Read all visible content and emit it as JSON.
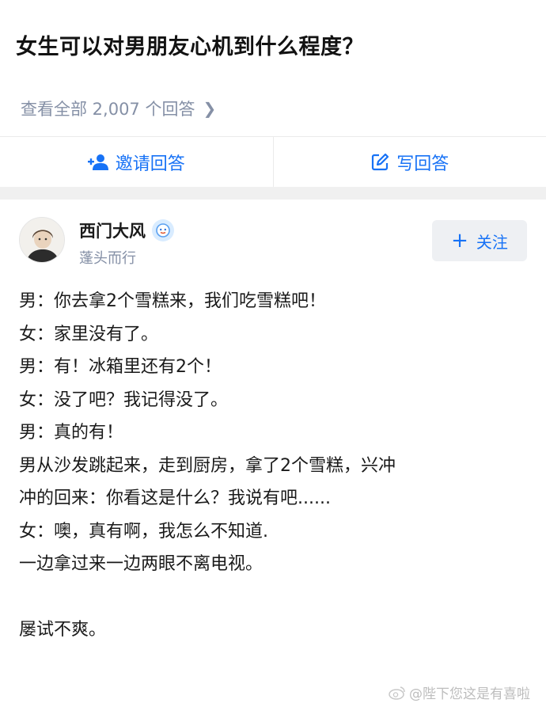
{
  "question": {
    "title": "女生可以对男朋友心机到什么程度？",
    "view_all": "查看全部 2,007 个回答"
  },
  "actions": {
    "invite": "邀请回答",
    "write": "写回答"
  },
  "author": {
    "name": "西门大风",
    "bio": "蓬头而行",
    "follow_label": "关注"
  },
  "answer": {
    "lines": [
      "男：你去拿2个雪糕来，我们吃雪糕吧！",
      "女：家里没有了。",
      "男：有！冰箱里还有2个！",
      "女：没了吧？我记得没了。",
      "男：真的有！",
      "男从沙发跳起来，走到厨房，拿了2个雪糕，兴冲",
      "冲的回来：你看这是什么？我说有吧......",
      "女：噢，真有啊，我怎么不知道.",
      "一边拿过来一边两眼不离电视。",
      "",
      "屡试不爽。"
    ]
  },
  "watermark": "@陛下您这是有喜啦",
  "colors": {
    "accent": "#1772f6",
    "muted": "#8590a6"
  }
}
